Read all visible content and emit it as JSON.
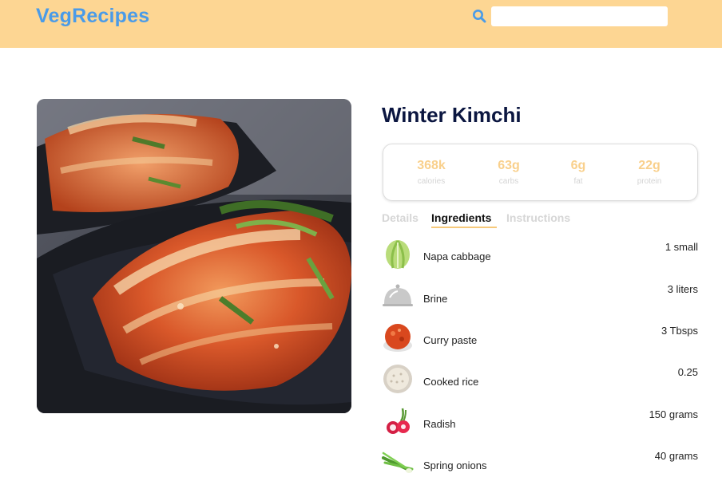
{
  "header": {
    "brand": "VegRecipes",
    "search_icon": "search-icon",
    "search_placeholder": ""
  },
  "recipe": {
    "title": "Winter Kimchi",
    "image_icon": "kimchi-photo"
  },
  "nutrition": [
    {
      "value": "368k",
      "label": "calories"
    },
    {
      "value": "63g",
      "label": "carbs"
    },
    {
      "value": "6g",
      "label": "fat"
    },
    {
      "value": "22g",
      "label": "protein"
    }
  ],
  "tabs": [
    {
      "label": "Details",
      "active": false
    },
    {
      "label": "Ingredients",
      "active": true
    },
    {
      "label": "Instructions",
      "active": false
    }
  ],
  "ingredients": [
    {
      "name": "Napa cabbage",
      "qty": "1 small",
      "icon": "cabbage-icon"
    },
    {
      "name": "Brine",
      "qty": "3 liters",
      "icon": "cloche-icon"
    },
    {
      "name": "Curry paste",
      "qty": "3 Tbsps",
      "icon": "curry-paste-icon"
    },
    {
      "name": "Cooked rice",
      "qty": "0.25",
      "icon": "rice-icon"
    },
    {
      "name": "Radish",
      "qty": "150 grams",
      "icon": "radish-icon"
    },
    {
      "name": "Spring onions",
      "qty": "40 grams",
      "icon": "spring-onion-icon"
    }
  ],
  "colors": {
    "header_bg": "#fdd693",
    "brand": "#4a9be8",
    "title": "#0b1640",
    "nutrition_value": "#f9d08c",
    "tab_underline": "#f7c97a"
  }
}
